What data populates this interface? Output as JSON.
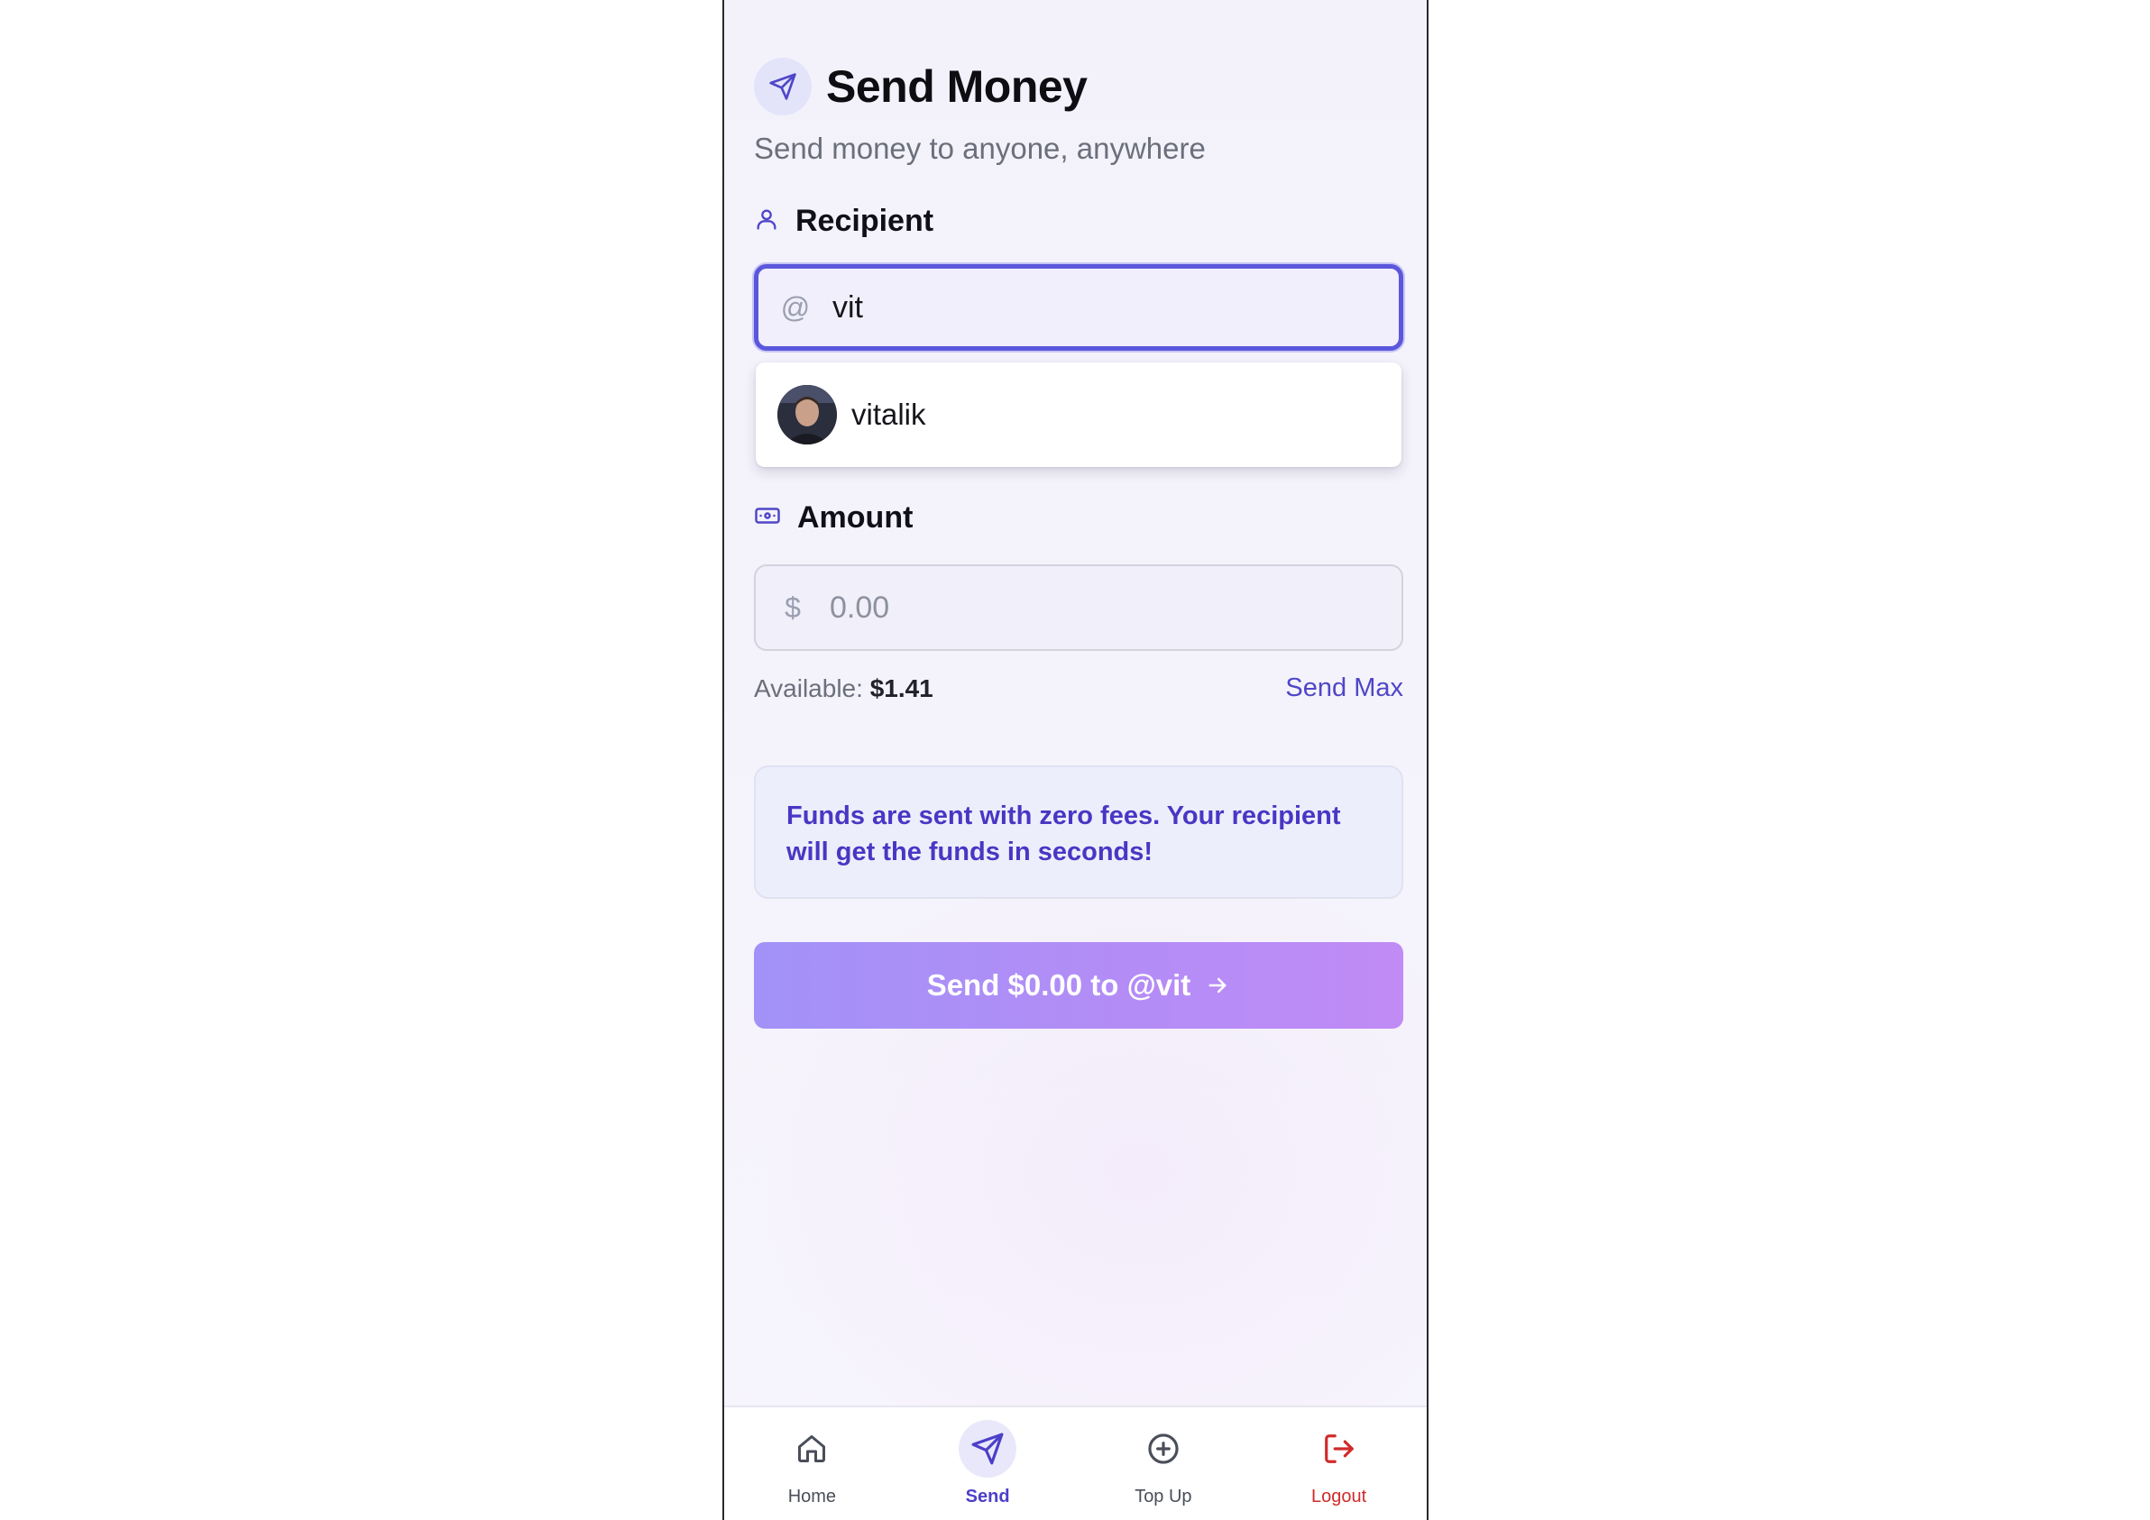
{
  "header": {
    "title": "Send Money",
    "subtitle": "Send money to anyone, anywhere",
    "icon": "send-icon"
  },
  "recipient": {
    "label": "Recipient",
    "prefix": "@",
    "value": "vit",
    "suggestions": [
      {
        "name": "vitalik"
      }
    ]
  },
  "amount": {
    "label": "Amount",
    "prefix": "$",
    "placeholder": "0.00",
    "available_label": "Available:",
    "available_value": "$1.41",
    "send_max_label": "Send Max"
  },
  "notice": {
    "text": "Funds are sent with zero fees. Your recipient will get the funds in seconds!"
  },
  "submit": {
    "label": "Send $0.00 to @vit"
  },
  "nav": {
    "items": [
      {
        "label": "Home",
        "icon": "home-icon"
      },
      {
        "label": "Send",
        "icon": "send-icon",
        "active": true
      },
      {
        "label": "Top Up",
        "icon": "plus-circle-icon"
      },
      {
        "label": "Logout",
        "icon": "logout-icon"
      }
    ]
  },
  "colors": {
    "accent": "#5b57dc",
    "accent_text": "#4a36c4",
    "danger": "#d12a2a",
    "button_gradient_start": "#a292f8",
    "button_gradient_end": "#c08bf5"
  }
}
